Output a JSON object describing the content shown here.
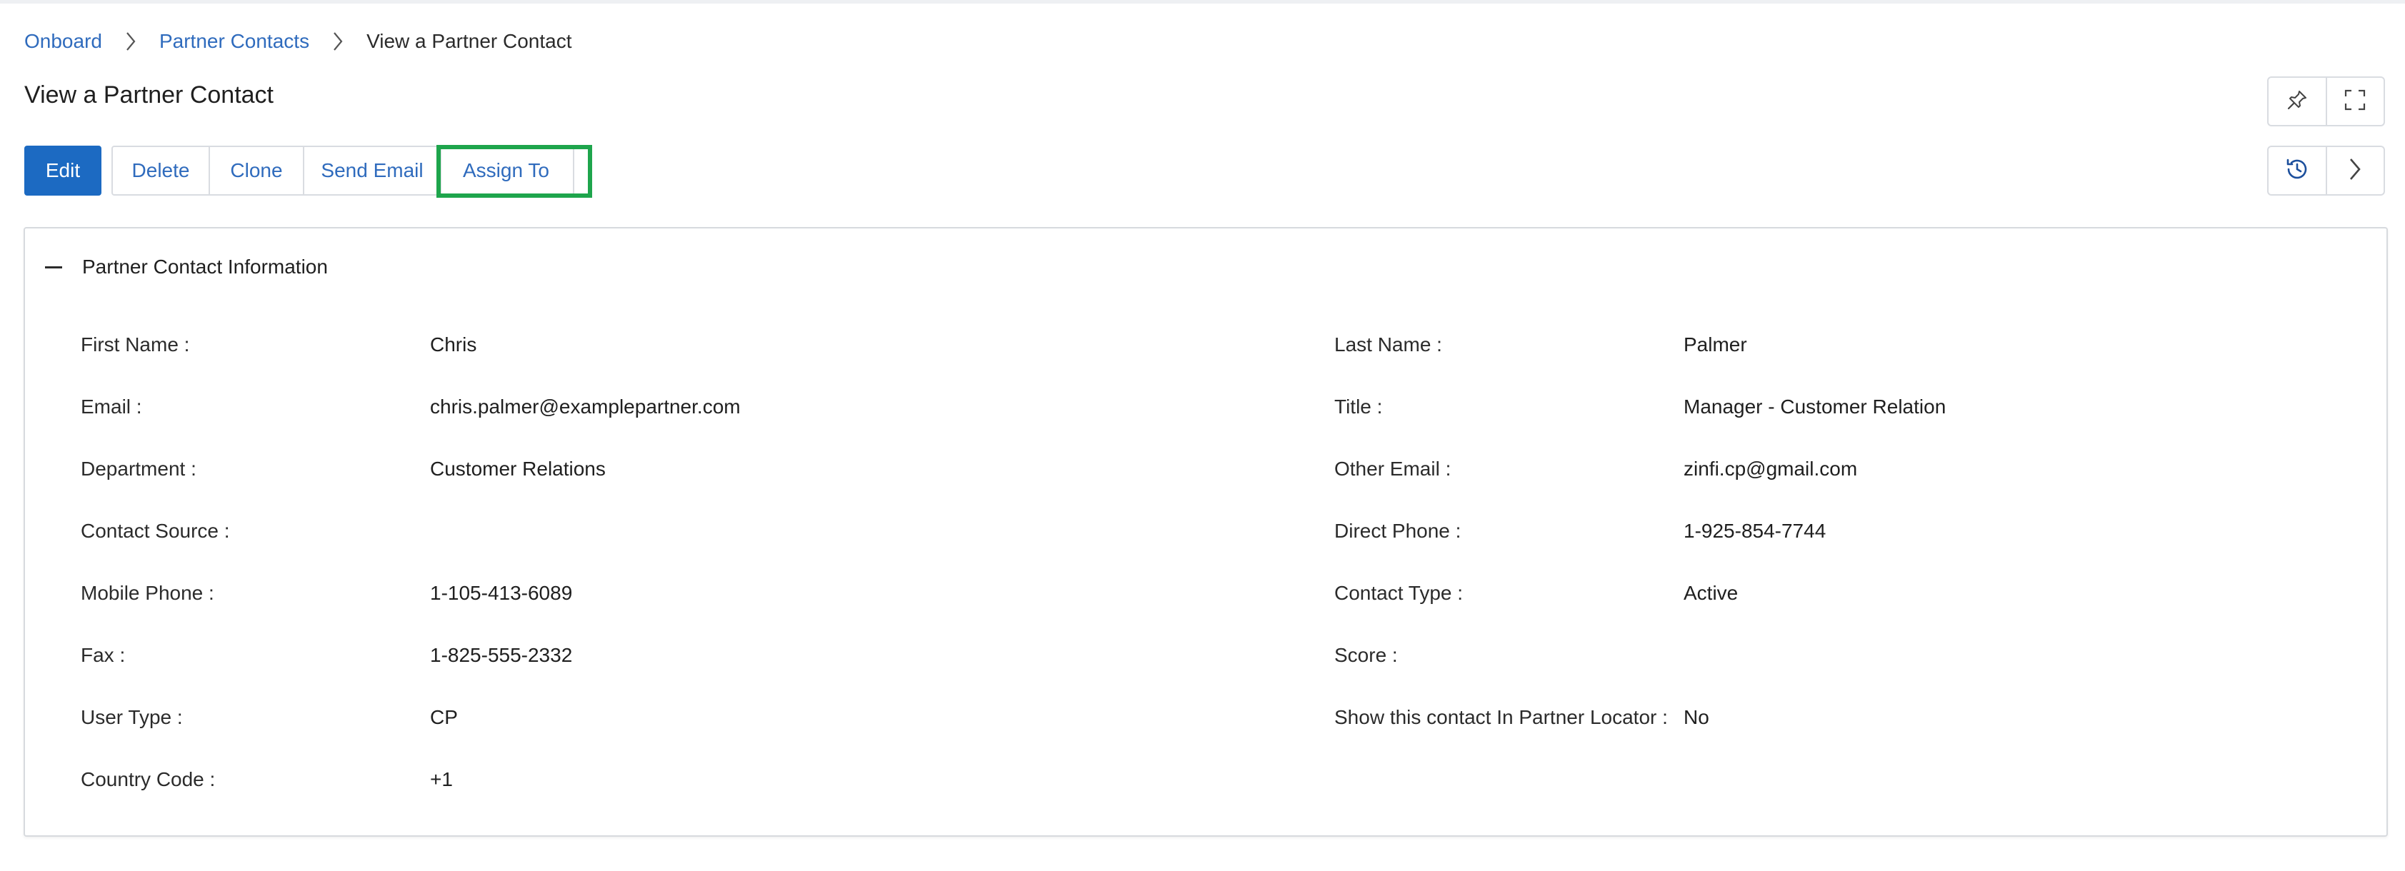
{
  "breadcrumb": {
    "items": [
      "Onboard",
      "Partner Contacts"
    ],
    "current": "View a Partner Contact"
  },
  "page": {
    "title": "View a Partner Contact"
  },
  "toolbar": {
    "edit": "Edit",
    "delete": "Delete",
    "clone": "Clone",
    "send_email": "Send Email",
    "assign_to": "Assign To"
  },
  "icons": {
    "pin": "pin-icon",
    "fullscreen": "fullscreen-icon",
    "history": "history-icon",
    "next": "chevron-right-icon"
  },
  "section": {
    "title": "Partner Contact Information",
    "left": [
      {
        "label": "First Name :",
        "value": "Chris"
      },
      {
        "label": "Email :",
        "value": "chris.palmer@examplepartner.com"
      },
      {
        "label": "Department :",
        "value": "Customer Relations"
      },
      {
        "label": "Contact Source :",
        "value": ""
      },
      {
        "label": "Mobile Phone :",
        "value": "1-105-413-6089"
      },
      {
        "label": "Fax :",
        "value": "1-825-555-2332"
      },
      {
        "label": "User Type :",
        "value": "CP"
      },
      {
        "label": "Country Code :",
        "value": "+1"
      }
    ],
    "right": [
      {
        "label": "Last Name :",
        "value": "Palmer"
      },
      {
        "label": "Title :",
        "value": "Manager - Customer Relation"
      },
      {
        "label": "Other Email :",
        "value": "zinfi.cp@gmail.com"
      },
      {
        "label": "Direct Phone :",
        "value": "1-925-854-7744"
      },
      {
        "label": "Contact Type :",
        "value": "Active"
      },
      {
        "label": "Score :",
        "value": ""
      },
      {
        "label": "Show this contact In Partner Locator :",
        "value": "No"
      }
    ]
  },
  "colors": {
    "primary": "#1c6ac2",
    "link": "#2f6bbd",
    "highlight": "#1ea54c",
    "border": "#d9dce1"
  }
}
